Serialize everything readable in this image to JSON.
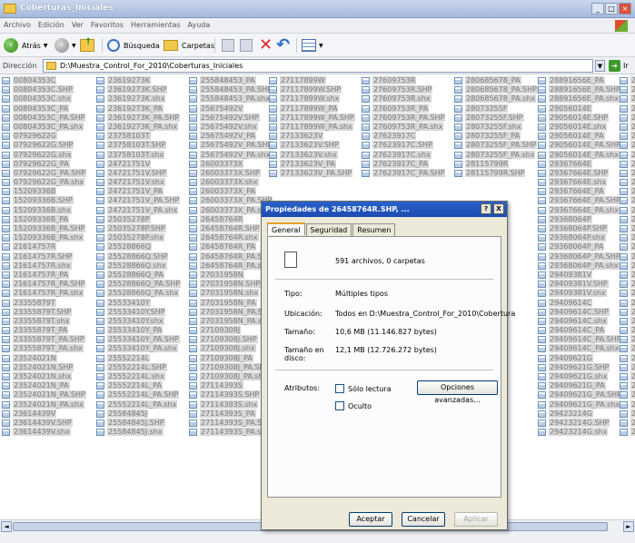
{
  "window": {
    "title": "Coberturas_Iniciales"
  },
  "menu": [
    "Archivo",
    "Edición",
    "Ver",
    "Favoritos",
    "Herramientas",
    "Ayuda"
  ],
  "toolbar": {
    "back_label": "Atrás",
    "search_label": "Búsqueda",
    "folders_label": "Carpetas"
  },
  "address": {
    "label": "Dirección",
    "path": "D:\\Muestra_Control_For_2010\\Coberturas_Iniciales",
    "go_label": "Ir"
  },
  "columns": [
    [
      "00804353C",
      "00804353C.SHP",
      "00804353C.shx",
      "00804353C_PA",
      "00804353C_PA.SHP",
      "00804353C_PA.shx",
      "07929622G",
      "07929622G.SHP",
      "07929622G.shx",
      "07929622G_PA",
      "07929622G_PA.SHP",
      "07929622G_PA.shx",
      "15209336B",
      "15209336B.SHP",
      "15209336B.shx",
      "15209336B_PA",
      "15209336B_PA.SHP",
      "15209336B_PA.shx",
      "21614757R",
      "21614757R.SHP",
      "21614757R.shx",
      "21614757R_PA",
      "21614757R_PA.SHP",
      "21614757R_PA.shx",
      "23355879T",
      "23355879T.SHP",
      "23355879T.shx",
      "23355879T_PA",
      "23355879T_PA.SHP",
      "23355879T_PA.shx",
      "23524021N",
      "23524021N.SHP",
      "23524021N.shx",
      "23524021N_PA",
      "23524021N_PA.SHP",
      "23524021N_PA.shx",
      "23614439V",
      "23614439V.SHP",
      "23614439V.shx"
    ],
    [
      "23619273K",
      "23619273K.SHP",
      "23619273K.shx",
      "23619273K_PA",
      "23619273K_PA.SHP",
      "23619273K_PA.shx",
      "23758103T",
      "23758103T.SHP",
      "23758103T.shx",
      "24721751V",
      "24721751V.SHP",
      "24721751V.shx",
      "24721751V_PA",
      "24721751V_PA.SHP",
      "24721751V_PA.shx",
      "25035278P",
      "25035278P.SHP",
      "25035278P.shx",
      "25528866Q",
      "25528866Q.SHP",
      "25528866Q.shx",
      "25528866Q_PA",
      "25528866Q_PA.SHP",
      "25528866Q_PA.shx",
      "25533410Y",
      "25533410Y.SHP",
      "25533410Y.shx",
      "25533410Y_PA",
      "25533410Y_PA.SHP",
      "25533410Y_PA.shx",
      "25552214L",
      "25552214L.SHP",
      "25552214L.shx",
      "25552214L_PA",
      "25552214L_PA.SHP",
      "25552214L_PA.shx",
      "25584845J",
      "25584845J.SHP",
      "25584845J.shx"
    ],
    [
      "255848453_PA",
      "255848453_PA.SHP",
      "255848453_PA.shx",
      "25675492V",
      "25675492V.SHP",
      "25675492V.shx",
      "25675492V_PA",
      "25675492V_PA.SHP",
      "25675492V_PA.shx",
      "26003373X",
      "26003373X.SHP",
      "26003373X.shx",
      "26003373X_PA",
      "26003373X_PA.SHP",
      "26003373X_PA.shx",
      "26458764R",
      "26458764R.SHP",
      "26458764R.shx",
      "26458764R_PA",
      "26458764R_PA.SHP",
      "26458764R_PA.shx",
      "27031958N",
      "27031958N.SHP",
      "27031958N.shx",
      "27031958N_PA",
      "27031958N_PA.SHP",
      "27031958N_PA.shx",
      "27109308J",
      "27109308J.SHP",
      "27109308J.shx",
      "27109308J_PA",
      "27109308J_PA.SHP",
      "27109308J_PA.shx",
      "27114393S",
      "27114393S.SHP",
      "27114393S.shx",
      "27114393S_PA",
      "27114393S_PA.SHP",
      "27114393S_PA.shx"
    ],
    [
      "27117899W",
      "27117899W.SHP",
      "27117899W.shx",
      "27117899W_PA",
      "27117899W_PA.SHP",
      "27117899W_PA.shx",
      "27133623V",
      "27133623V.SHP",
      "27133623V.shx",
      "27133623V_PA",
      "27133623V_PA.SHP"
    ],
    [
      "27609753R",
      "27609753R.SHP",
      "27609753R.shx",
      "27609753R_PA",
      "27609753R_PA.SHP",
      "27609753R_PA.shx",
      "27623917C",
      "27623917C.SHP",
      "27623917C.shx",
      "27623917C_PA",
      "27623917C_PA.SHP"
    ],
    [
      "280685678_PA",
      "280685678_PA.SHP",
      "280685678_PA.shx",
      "28073255F",
      "28073255F.SHP",
      "28073255F.shx",
      "28073255F_PA",
      "28073255F_PA.SHP",
      "28073255F_PA.shx",
      "28115799R",
      "28115799R.SHP"
    ],
    [
      "28891656E_PA",
      "28891656E_PA.SHP",
      "28891656E_PA.shx",
      "29056014E",
      "29056014E.SHP",
      "29056014E.shx",
      "29056014E_PA",
      "29056014E_PA.SHP",
      "29056014E_PA.shx",
      "29367664E",
      "29367664E.SHP",
      "29367664E.shx",
      "29367664E_PA",
      "29367664E_PA.SHP",
      "29367664E_PA.shx",
      "29368064P",
      "29368064P.SHP",
      "29368064P.shx",
      "29368064P_PA",
      "29368064P_PA.SHP",
      "29368064P_PA.shx",
      "29409381V",
      "29409381V.SHP",
      "29409381V.shx",
      "29409614C",
      "29409614C.SHP",
      "29409614C.shx",
      "29409614C_PA",
      "29409614C_PA.SHP",
      "29409614C_PA.shx",
      "29409621G",
      "29409621G.SHP",
      "29409621G.shx",
      "29409621G_PA",
      "29409621G_PA.SHP",
      "29409621G_PA.shx",
      "29423214G",
      "29423214G.SHP",
      "29423214G.shx"
    ],
    [
      "294",
      "294",
      "294",
      "294",
      "294",
      "294",
      "294",
      "294",
      "294",
      "294",
      "294",
      "294",
      "294",
      "294",
      "294",
      "294",
      "294",
      "294",
      "296",
      "296",
      "296",
      "296",
      "296",
      "296",
      "296",
      "296",
      "296",
      "296",
      "296",
      "296",
      "297",
      "297",
      "297",
      "297",
      "297",
      "297",
      "297",
      "297",
      "297"
    ]
  ],
  "dialog": {
    "title": "Propiedades de 26458764R.SHP, ...",
    "help_button": "?",
    "close_button": "X",
    "tabs": [
      "General",
      "Seguridad",
      "Resumen"
    ],
    "summary": "591 archivos, 0 carpetas",
    "type_label": "Tipo:",
    "type_value": "Múltiples tipos",
    "location_label": "Ubicación:",
    "location_value": "Todos en D:\\Muestra_Control_For_2010\\Cobertura",
    "size_label": "Tamaño:",
    "size_value": "10,6 MB (11.146.827 bytes)",
    "disk_size_label": "Tamaño en disco:",
    "disk_size_value": "12,1 MB (12.726.272 bytes)",
    "attributes_label": "Atributos:",
    "readonly_label": "Sólo lectura",
    "hidden_label": "Oculto",
    "advanced_button": "Opciones avanzadas...",
    "ok_button": "Aceptar",
    "cancel_button": "Cancelar",
    "apply_button": "Aplicar"
  }
}
